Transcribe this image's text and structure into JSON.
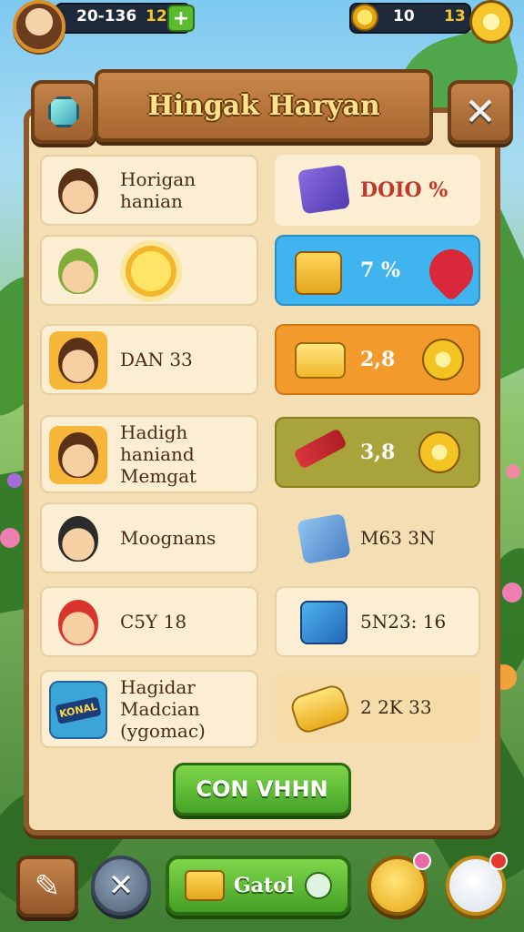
{
  "hud": {
    "left_value": "20-136",
    "level": "12",
    "right_value": "10",
    "coins": "13"
  },
  "title": "Hingak Haryan",
  "rows": [
    {
      "name": "Horigan hanian",
      "reward": "DOIO %",
      "reward_color": "#c0392b",
      "bg": "#fbeed2"
    },
    {
      "name": "",
      "reward": "7 %",
      "reward_color": "#ffffff",
      "bg": "#3fb4ee"
    },
    {
      "name": "DAN 33",
      "reward": "2,8",
      "reward_color": "#ffffff",
      "bg": "#f29a2c"
    },
    {
      "name": "Hadigh haniand Memgat",
      "reward": "3,8",
      "reward_color": "#ffffff",
      "bg": "#a9a33c"
    },
    {
      "name": "Moognans",
      "reward": "M63 3N",
      "reward_color": "#3a2818",
      "bg": "#f4dfb5"
    },
    {
      "name": "C5Y 18",
      "reward": "5N23: 16",
      "reward_color": "#3a2818",
      "bg": "#fbeed2"
    },
    {
      "name": "Hagidar Madcian (ygomac)",
      "reward": "2 2K 33",
      "reward_color": "#3a2818",
      "bg": "#f6dca8"
    }
  ],
  "row_badge": "KONAL",
  "collect_label": "CON VHHN",
  "bottom": {
    "main_label": "Gatol"
  },
  "icons": {
    "hud_add": "+",
    "close": "✕",
    "edit": "✎"
  }
}
